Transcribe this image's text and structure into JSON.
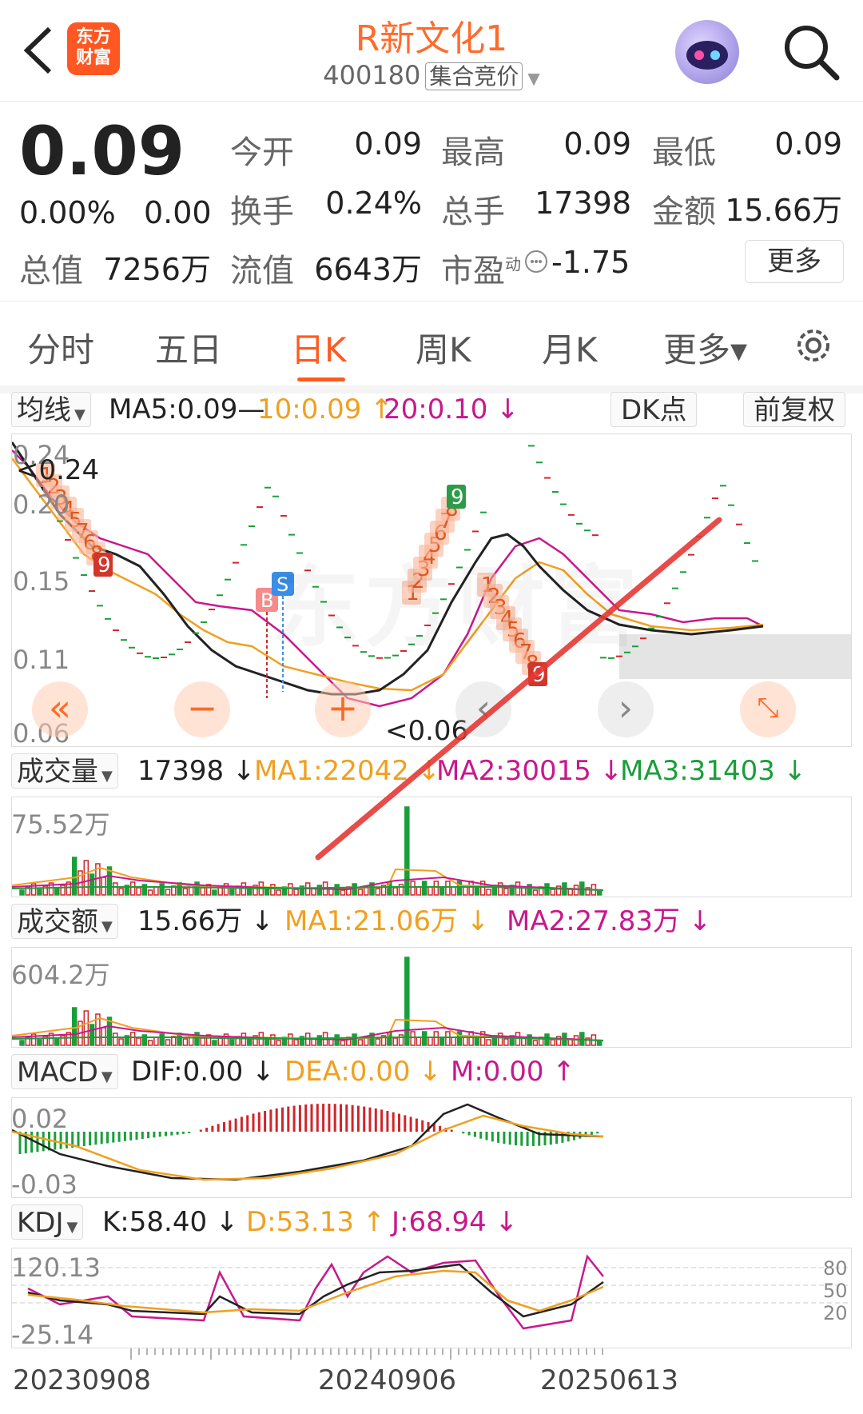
{
  "header": {
    "logo_text_1": "东方",
    "logo_text_2": "财富",
    "title": "R新文化1",
    "code": "400180",
    "badge": "集合竞价"
  },
  "quote": {
    "price": "0.09",
    "change_pct": "0.00%",
    "change": "0.00",
    "open_label": "今开",
    "open": "0.09",
    "high_label": "最高",
    "high": "0.09",
    "low_label": "最低",
    "low": "0.09",
    "turnover_label": "换手",
    "turnover": "0.24%",
    "volume_label": "总手",
    "volume": "17398",
    "amount_label": "金额",
    "amount": "15.66万",
    "total_cap_label": "总值",
    "total_cap": "7256万",
    "float_cap_label": "流值",
    "float_cap": "6643万",
    "pe_label": "市盈",
    "pe_sup": "动",
    "pe": "-1.75",
    "more": "更多"
  },
  "tabs": [
    {
      "label": "分时"
    },
    {
      "label": "五日"
    },
    {
      "label": "日K"
    },
    {
      "label": "周K"
    },
    {
      "label": "月K"
    },
    {
      "label": "更多▾"
    }
  ],
  "active_tab": "日K",
  "colors": {
    "accent": "#ff5a1f",
    "up": "#d0262b",
    "down": "#1a9e3a",
    "ma_orange": "#f0a020",
    "ma_magenta": "#c8188c"
  },
  "kline": {
    "selector": "均线",
    "ma5": "MA5:0.09—",
    "ma10": "10:0.09",
    "ma10_arrow": "↑",
    "ma20": "20:0.10",
    "ma20_arrow": "↓",
    "dk_button": "DK点",
    "adjust_button": "前复权",
    "y_ticks": [
      "0.24",
      "0.20",
      "0.15",
      "0.11",
      "0.06"
    ],
    "max_label": "<0.24",
    "min_label": "<0.06",
    "buy_marker": "B",
    "sell_marker": "S",
    "td_left_nums": [
      "1",
      "2",
      "3",
      "4",
      "5",
      "7",
      "6",
      "8",
      "9"
    ],
    "td_mid_nums": [
      "1",
      "2",
      "3",
      "4",
      "5",
      "6",
      "7",
      "8",
      "9"
    ],
    "td_right_nums": [
      "1",
      "2",
      "3",
      "4",
      "5",
      "6",
      "7",
      "8",
      "9"
    ]
  },
  "volume": {
    "selector": "成交量",
    "value": "17398",
    "value_arrow": "↓",
    "ma1": "MA1:22042",
    "ma1_arrow": "↓",
    "ma2": "MA2:30015",
    "ma2_arrow": "↓",
    "ma3": "MA3:31403",
    "ma3_arrow": "↓",
    "y_max": "75.52万"
  },
  "amount": {
    "selector": "成交额",
    "value": "15.66万",
    "value_arrow": "↓",
    "ma1": "MA1:21.06万",
    "ma1_arrow": "↓",
    "ma2": "MA2:27.83万",
    "ma2_arrow": "↓",
    "y_max": "604.2万"
  },
  "macd": {
    "selector": "MACD",
    "dif": "DIF:0.00",
    "dif_arrow": "↓",
    "dea": "DEA:0.00",
    "dea_arrow": "↓",
    "m": "M:0.00",
    "m_arrow": "↑",
    "y_max": "0.02",
    "y_min": "-0.03"
  },
  "kdj": {
    "selector": "KDJ",
    "k": "K:58.40",
    "k_arrow": "↓",
    "d": "D:53.13",
    "d_arrow": "↑",
    "j": "J:68.94",
    "j_arrow": "↓",
    "y_max": "120.13",
    "y_min": "-25.14",
    "levels": [
      "80",
      "50",
      "20"
    ]
  },
  "dates": [
    "20230908",
    "20240906",
    "20250613"
  ]
}
